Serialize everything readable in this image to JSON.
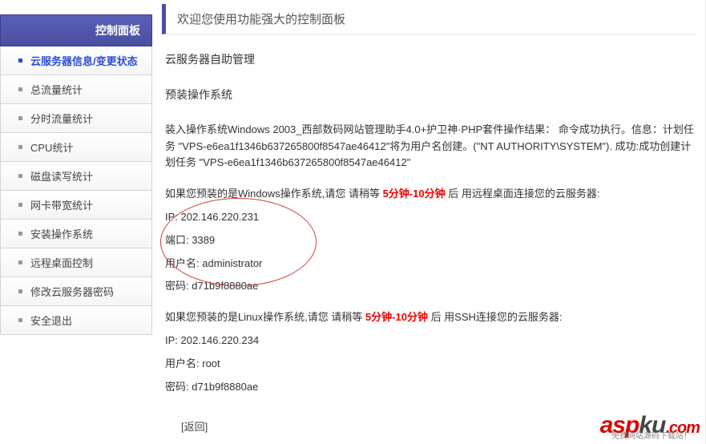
{
  "sidebar": {
    "title": "控制面板",
    "items": [
      {
        "label": "云服务器信息/变更状态",
        "active": true
      },
      {
        "label": "总流量统计",
        "active": false
      },
      {
        "label": "分时流量统计",
        "active": false
      },
      {
        "label": "CPU统计",
        "active": false
      },
      {
        "label": "磁盘读写统计",
        "active": false
      },
      {
        "label": "网卡带宽统计",
        "active": false
      },
      {
        "label": "安装操作系统",
        "active": false
      },
      {
        "label": "远程桌面控制",
        "active": false
      },
      {
        "label": "修改云服务器密码",
        "active": false
      },
      {
        "label": "安全退出",
        "active": false
      }
    ]
  },
  "header": {
    "welcome": "欢迎您使用功能强大的控制面板"
  },
  "content": {
    "title": "云服务器自助管理",
    "section": "预装操作系统",
    "result_text": "装入操作系统Windows 2003_西部数码网站管理助手4.0+护卫神·PHP套件操作结果：  命令成功执行。信息：计划任务 \"VPS-e6ea1f1346b637265800f8547ae46412\"将为用户名创建。(\"NT AUTHORITY\\SYSTEM\"). 成功:成功创建计划任务 \"VPS-e6ea1f1346b637265800f8547ae46412\"",
    "windows_intro_a": "如果您预装的是Windows操作系统,请您 请稍等 ",
    "wait_time": "5分钟-10分钟",
    "windows_intro_b": " 后 用远程桌面连接您的云服务器:",
    "win_ip_label": "IP: ",
    "win_ip": "202.146.220.231",
    "win_port_label": "端口: ",
    "win_port": "3389",
    "win_user_label": "用户名: ",
    "win_user": "administrator",
    "win_pass_label": "密码: ",
    "win_pass": "d71b9f8880ae",
    "linux_intro_a": "如果您预装的是Linux操作系统,请您 请稍等 ",
    "linux_intro_b": " 后 用SSH连接您的云服务器:",
    "lin_ip_label": "IP: ",
    "lin_ip": "202.146.220.234",
    "lin_user_label": "用户名: ",
    "lin_user": "root",
    "lin_pass_label": "密码: ",
    "lin_pass": "d71b9f8880ae",
    "back": "[返回]"
  },
  "watermark": {
    "asp": "asp",
    "ku": "ku",
    "dot": ".",
    "com": "com",
    "sub": "免费网站源码下载站！"
  }
}
